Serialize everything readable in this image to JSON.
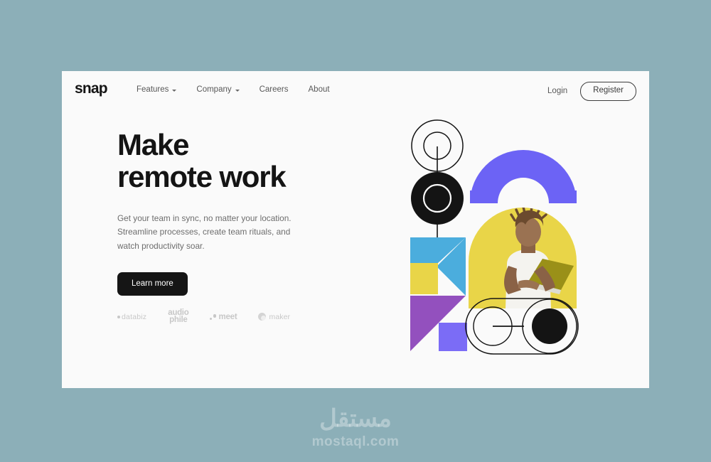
{
  "page": {
    "background_color": "#8CAFB8",
    "card_background": "#FAFAFA"
  },
  "navbar": {
    "brand": "snap",
    "links": [
      {
        "label": "Features",
        "has_dropdown": true,
        "icon": "chevron-down-icon"
      },
      {
        "label": "Company",
        "has_dropdown": true,
        "icon": "chevron-down-icon"
      },
      {
        "label": "Careers",
        "has_dropdown": false
      },
      {
        "label": "About",
        "has_dropdown": false
      }
    ],
    "login_label": "Login",
    "register_label": "Register"
  },
  "hero": {
    "heading": "Make\nremote work",
    "paragraph": "Get your team in sync, no matter your location.\nStreamline processes, create team rituals, and\nwatch productivity soar.",
    "cta_label": "Learn more"
  },
  "clients": {
    "items": [
      {
        "name": "databiz",
        "label": "databiz",
        "icon": "dot-icon"
      },
      {
        "name": "audiophile",
        "label_top": "audio",
        "label_bottom": "phile"
      },
      {
        "name": "meet",
        "label": "meet",
        "icon": "two-dots-icon"
      },
      {
        "name": "maker",
        "label": "maker",
        "icon": "ring-icon"
      }
    ]
  },
  "artwork": {
    "description": "geometric hero collage with photo of person using laptop",
    "colors": {
      "purple_arch": "#6C63F5",
      "yellow": "#E9D548",
      "cyan": "#4BADDD",
      "violet": "#9350BE",
      "blue_square": "#7B6CF6",
      "black": "#141414",
      "stroke": "#141414",
      "skin": "#8a6246",
      "shirt": "#F4F3EF",
      "laptop": "#9A9018"
    }
  },
  "watermark": {
    "arabic": "مستقل",
    "latin": "mostaql.com"
  }
}
